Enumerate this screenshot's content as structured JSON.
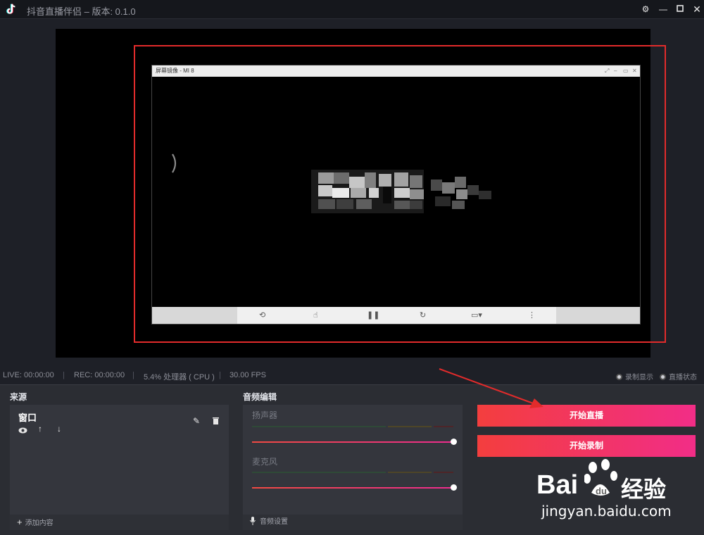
{
  "app": {
    "title": "抖音直播伴侣 – 版本: 0.1.0",
    "logo_icon": "douyin-logo-icon",
    "window_controls": [
      "gear-icon",
      "minimize-icon",
      "maximize-icon",
      "close-icon"
    ]
  },
  "preview": {
    "mirror_window_title": "屏幕镜像 - MI 8",
    "mirror_controls": [
      "rotate-icon",
      "touch-icon",
      "pause-icon",
      "refresh-icon",
      "camera-icon",
      "more-icon"
    ]
  },
  "status": {
    "live": "LIVE: 00:00:00",
    "rec": "REC: 00:00:00",
    "cpu": "5.4% 处理器 ( CPU )",
    "fps": "30.00 FPS",
    "legend_recording": "录制显示",
    "legend_live": "直播状态"
  },
  "sources": {
    "title": "来源",
    "item_name": "窗口",
    "add_label": "添加内容"
  },
  "audio": {
    "title": "音频编辑",
    "speaker_label": "扬声器",
    "mic_label": "麦克风",
    "settings_label": "音频设置",
    "speaker_volume": 1.0,
    "mic_volume": 1.0
  },
  "actions": {
    "start_live": "开始直播",
    "start_record": "开始录制"
  },
  "watermark": {
    "brand_left": "Bai",
    "brand_right": "经验",
    "url": "jingyan.baidu.com"
  },
  "colors": {
    "accent_start": "#f33e3e",
    "accent_end": "#f22d87",
    "annotation_red": "#e22b2b"
  }
}
